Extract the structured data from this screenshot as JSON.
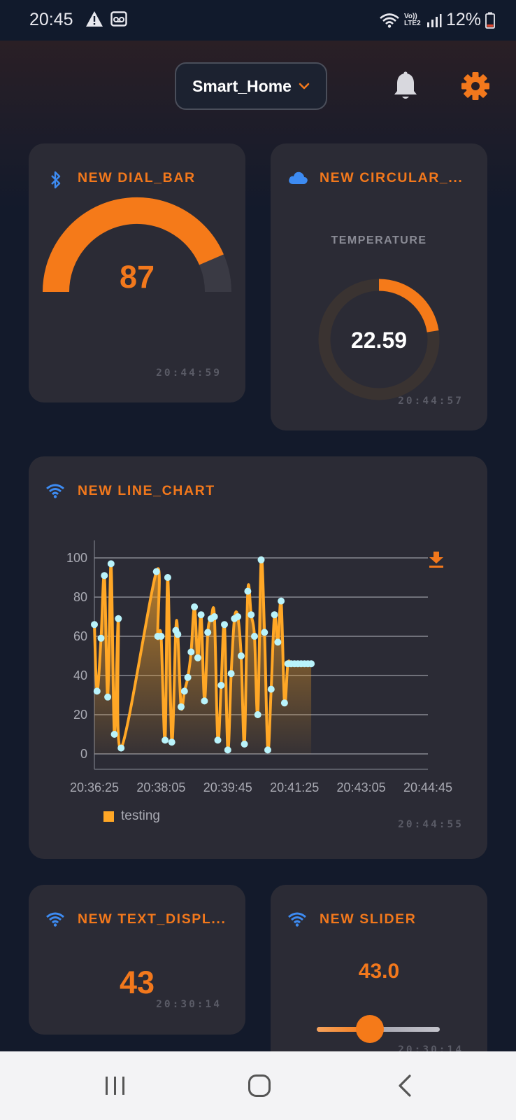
{
  "status_bar": {
    "time": "20:45",
    "network": "Vo)) LTE2",
    "battery": "12%"
  },
  "header": {
    "project_name": "Smart_Home",
    "notifications_icon": "bell-icon",
    "settings_icon": "gear-icon"
  },
  "widgets": {
    "dial_bar": {
      "title": "NEW DIAL_BAR",
      "icon": "bluetooth-icon",
      "value": "87",
      "fraction": 0.87,
      "timestamp": "20:44:59"
    },
    "circular": {
      "title": "NEW CIRCULAR_...",
      "icon": "cloud-icon",
      "label": "TEMPERATURE",
      "value": "22.59",
      "fraction": 0.2259,
      "timestamp": "20:44:57"
    },
    "line_chart": {
      "title": "NEW LINE_CHART",
      "icon": "wifi-icon",
      "download_icon": "download-icon",
      "timestamp": "20:44:55"
    },
    "text_display": {
      "title": "NEW TEXT_DISPL...",
      "icon": "wifi-icon",
      "value": "43",
      "timestamp": "20:30:14"
    },
    "slider": {
      "title": "NEW SLIDER",
      "icon": "wifi-icon",
      "value": "43.0",
      "fraction": 0.43,
      "timestamp": "20:30:14"
    }
  },
  "colors": {
    "accent": "#f2781c",
    "line": "#ffa726",
    "point": "#b9f3fb",
    "card": "#2b2b35",
    "background": "#131a2b"
  },
  "chart_data": {
    "type": "line",
    "title": "",
    "xlabel": "",
    "ylabel": "",
    "ylim": [
      0,
      100
    ],
    "yticks": [
      "0",
      "20",
      "40",
      "60",
      "80",
      "100"
    ],
    "xticks": [
      "20:36:25",
      "20:38:05",
      "20:39:45",
      "20:41:25",
      "20:43:05",
      "20:44:45"
    ],
    "grid": true,
    "legend": "bottom-left",
    "series": [
      {
        "name": "testing",
        "x": [
          "20:36:25",
          "20:36:29",
          "20:36:35",
          "20:36:40",
          "20:36:45",
          "20:36:50",
          "20:36:55",
          "20:37:01",
          "20:37:05",
          "20:37:58",
          "20:38:00",
          "20:38:05",
          "20:38:11",
          "20:38:15",
          "20:38:21",
          "20:38:27",
          "20:38:30",
          "20:38:35",
          "20:38:40",
          "20:38:45",
          "20:38:50",
          "20:38:55",
          "20:39:00",
          "20:39:05",
          "20:39:10",
          "20:39:15",
          "20:39:20",
          "20:39:25",
          "20:39:30",
          "20:39:35",
          "20:39:40",
          "20:39:45",
          "20:39:50",
          "20:39:55",
          "20:40:00",
          "20:40:05",
          "20:40:10",
          "20:40:15",
          "20:40:20",
          "20:40:25",
          "20:40:30",
          "20:40:35",
          "20:40:40",
          "20:40:45",
          "20:40:50",
          "20:40:55",
          "20:41:00",
          "20:41:05",
          "20:41:10",
          "20:41:15",
          "20:41:20",
          "20:41:25",
          "20:41:30",
          "20:41:35",
          "20:41:40",
          "20:41:45",
          "20:41:50"
        ],
        "values": [
          66,
          32,
          59,
          91,
          29,
          97,
          10,
          69,
          3,
          93,
          60,
          60,
          7,
          90,
          6,
          63,
          61,
          24,
          32,
          39,
          52,
          75,
          49,
          71,
          27,
          62,
          69,
          70,
          7,
          35,
          66,
          2,
          41,
          69,
          70,
          50,
          5,
          83,
          71,
          60,
          20,
          99,
          62,
          2,
          33,
          71,
          57,
          78,
          26,
          46,
          46,
          46,
          46,
          46,
          46,
          46,
          46
        ]
      }
    ]
  }
}
